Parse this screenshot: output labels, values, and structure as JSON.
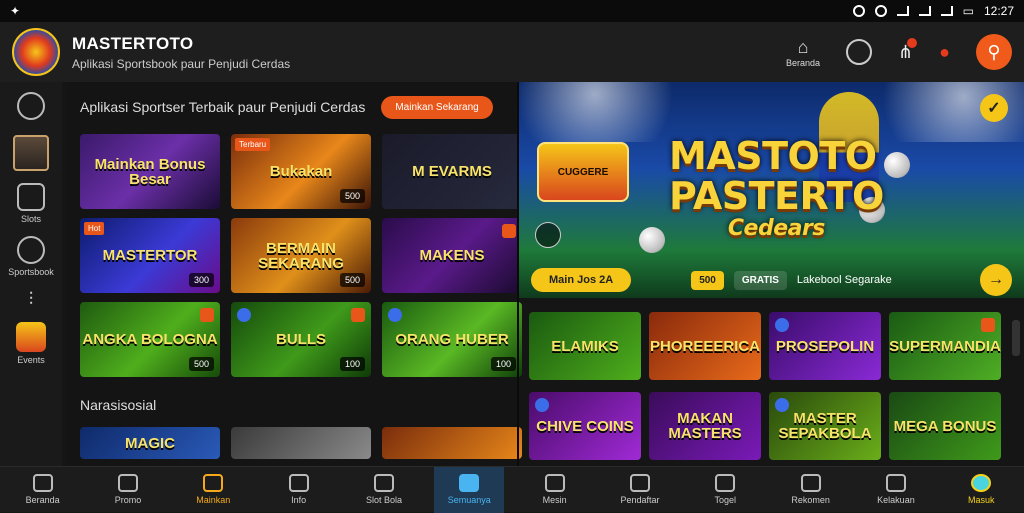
{
  "statusbar": {
    "time": "12:27"
  },
  "header": {
    "brand_name": "MASTERTOTO",
    "tagline": "Aplikasi Sportsbook paur Penjudi Cerdas",
    "home_label": "Beranda"
  },
  "sidebar": {
    "items": [
      {
        "label": ""
      },
      {
        "label": ""
      },
      {
        "label": "Slots"
      },
      {
        "label": "Sportsbook"
      },
      {
        "label": ""
      },
      {
        "label": "Events"
      }
    ]
  },
  "section1": {
    "title": "Aplikasi Sportser Terbaik paur Penjudi Cerdas",
    "pill": "Mainkan Sekarang"
  },
  "games": [
    {
      "title": "Mainkan Bonus Besar",
      "badge": ""
    },
    {
      "title": "Bukakan",
      "tag": "Terbaru",
      "badge": "500"
    },
    {
      "title": "M EVARMS",
      "badge": ""
    },
    {
      "title": "MASTERTOR",
      "tag": "Hot",
      "badge": "300"
    },
    {
      "title": "BERMAIN SEKARANG",
      "badge": "500"
    },
    {
      "title": "MAKENS",
      "badge": ""
    },
    {
      "title": "ANGKA BOLOGNA",
      "badge": "500"
    },
    {
      "title": "BULLS",
      "badge": "100"
    },
    {
      "title": "ORANG HUBER",
      "badge": "100"
    }
  ],
  "section2": {
    "title": "Narasisosial"
  },
  "row2": [
    {
      "title": "MAGIC"
    },
    {
      "title": ""
    },
    {
      "title": ""
    }
  ],
  "hero": {
    "badge_text": "CUGGERE",
    "title_line1": "MASTOTO",
    "title_line2": "PASTERTO",
    "title_sub": "Cedears",
    "button": "Main Jos 2A",
    "chip1": "500",
    "chip2": "GRATIS",
    "label": "Lakebool Segarake"
  },
  "right_games": [
    {
      "title": "ELAMIKS"
    },
    {
      "title": "PHOREEERICA"
    },
    {
      "title": "PROSEPOLIN"
    },
    {
      "title": "SUPERMANDIA"
    },
    {
      "title": "CHIVE COINS"
    },
    {
      "title": "MAKAN MASTERS"
    },
    {
      "title": "MASTER SEPAKBOLA"
    },
    {
      "title": "MEGA BONUS"
    }
  ],
  "bottom_nav": [
    {
      "label": "Beranda"
    },
    {
      "label": "Promo"
    },
    {
      "label": "Mainkan"
    },
    {
      "label": "Info"
    },
    {
      "label": "Slot Bola"
    },
    {
      "label": "Semuanya"
    },
    {
      "label": "Mesin"
    },
    {
      "label": "Pendaftar"
    },
    {
      "label": "Togel"
    },
    {
      "label": "Rekomen"
    },
    {
      "label": "Kelakuan"
    },
    {
      "label": "Masuk"
    }
  ]
}
